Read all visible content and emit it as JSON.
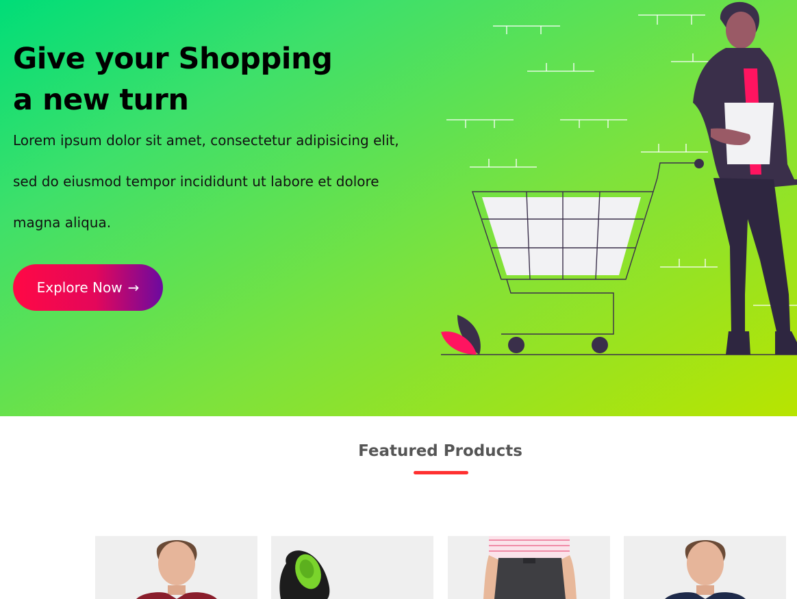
{
  "hero": {
    "title_line1": "Give your Shopping",
    "title_line2": "a new turn",
    "text_line1": "Lorem ipsum dolor sit amet, consectetur adipisicing elit,",
    "text_line2": "sed do eiusmod tempor incididunt ut labore et dolore",
    "text_line3": "magna aliqua.",
    "button_label": "Explore Now",
    "button_icon": "arrow-right-icon",
    "button_arrow": "→"
  },
  "featured": {
    "title": "Featured Products",
    "products": [
      {
        "image": "man-portrait-red-shirt"
      },
      {
        "image": "black-shoe-green-insole"
      },
      {
        "image": "man-striped-shirt-grey-pants"
      },
      {
        "image": "man-portrait-navy-shirt"
      }
    ]
  },
  "colors": {
    "hero_gradient_start": "#00dd78",
    "hero_gradient_end": "#b8e400",
    "button_gradient_start": "#ff0845",
    "button_gradient_end": "#6b0aa0",
    "accent_underline": "#ff3030",
    "illustration_dark": "#3a2f4a",
    "illustration_pink": "#ff1460"
  }
}
